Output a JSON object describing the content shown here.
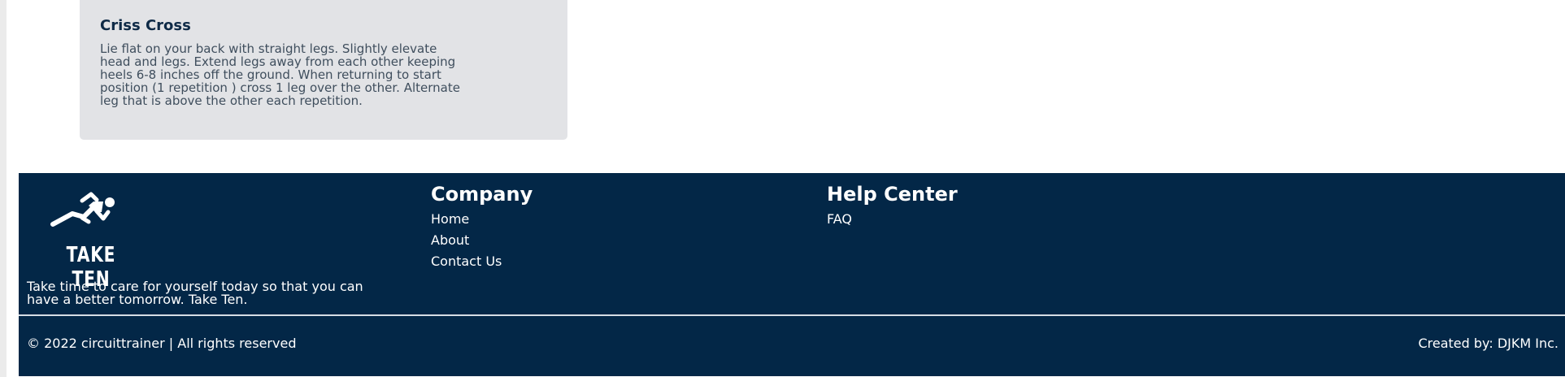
{
  "card": {
    "title": "Criss Cross",
    "description": "Lie flat on your back with straight legs. Slightly elevate head and legs. Extend legs away from each other keeping heels 6-8 inches off the ground. When returning to start position (1 repetition ) cross 1 leg over the other. Alternate leg that is above the other each repetition."
  },
  "footer": {
    "logo": {
      "icon": "runner-icon",
      "text": "TAKE TEN"
    },
    "tagline": "Take time to care for yourself today so that you can have a better tomorrow. Take Ten.",
    "company": {
      "heading": "Company",
      "links": [
        "Home",
        "About",
        "Contact Us"
      ]
    },
    "help_center": {
      "heading": "Help Center",
      "links": [
        "FAQ"
      ]
    },
    "copyright": "© 2022 circuittrainer | All rights reserved",
    "credit": "Created by: DJKM Inc."
  },
  "colors": {
    "footer_bg": "#032747",
    "card_bg": "#e2e3e6",
    "card_title": "#0e2a47",
    "card_text": "#3f4e5d"
  }
}
